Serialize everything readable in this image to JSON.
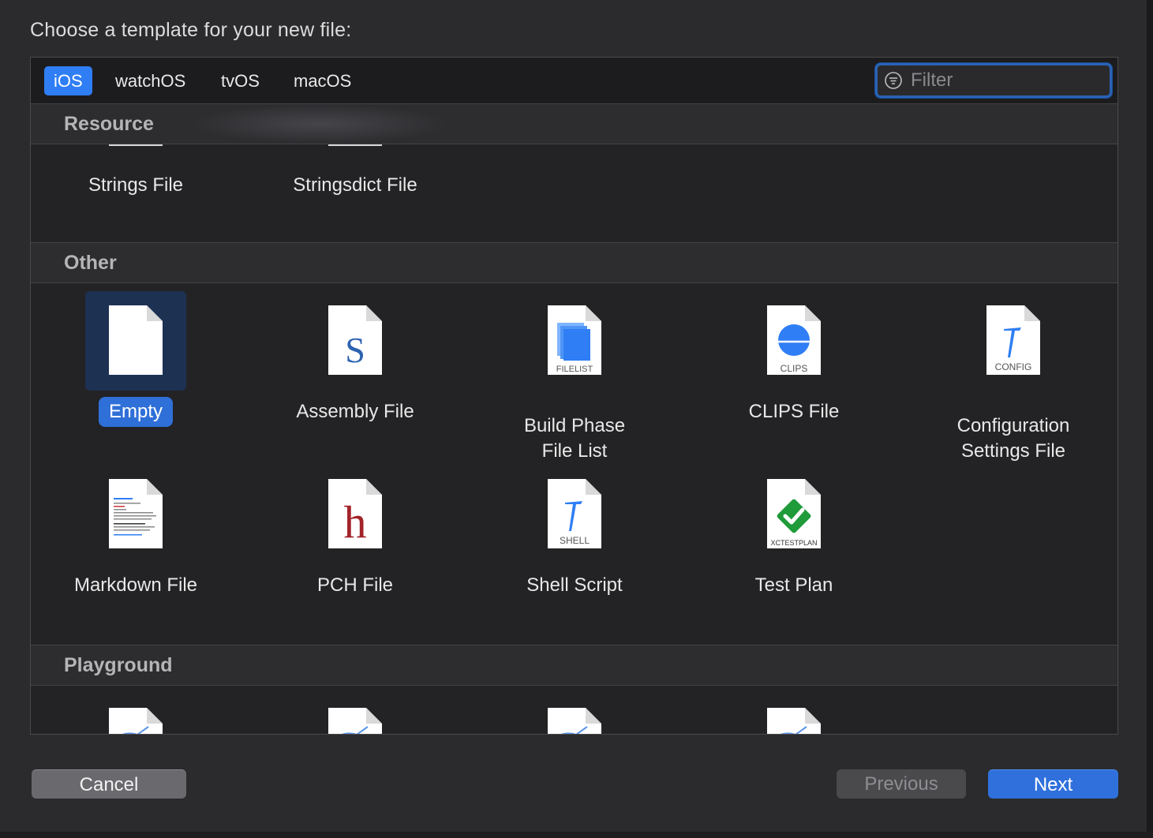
{
  "prompt": "Choose a template for your new file:",
  "tabs": [
    {
      "label": "iOS",
      "active": true
    },
    {
      "label": "watchOS"
    },
    {
      "label": "tvOS"
    },
    {
      "label": "macOS"
    }
  ],
  "filter": {
    "placeholder": "Filter"
  },
  "sections": {
    "resource": {
      "title": "Resource",
      "items": [
        {
          "label": "Strings File"
        },
        {
          "label": "Stringsdict File"
        }
      ]
    },
    "other": {
      "title": "Other",
      "items": [
        {
          "label": "Empty",
          "icon": "blank-file-icon",
          "selected": true
        },
        {
          "label": "Assembly File",
          "icon": "assembly-file-icon",
          "glyph": "S"
        },
        {
          "label": "Build Phase\nFile List",
          "icon": "filelist-file-icon",
          "badge": "FILELIST"
        },
        {
          "label": "CLIPS File",
          "icon": "clips-file-icon",
          "badge": "CLIPS"
        },
        {
          "label": "Configuration\nSettings File",
          "icon": "config-file-icon",
          "badge": "CONFIG"
        },
        {
          "label": "Markdown File",
          "icon": "markdown-file-icon"
        },
        {
          "label": "PCH File",
          "icon": "pch-file-icon",
          "glyph": "h"
        },
        {
          "label": "Shell Script",
          "icon": "shell-file-icon",
          "badge": "SHELL"
        },
        {
          "label": "Test Plan",
          "icon": "testplan-file-icon",
          "badge": "XCTESTPLAN"
        }
      ]
    },
    "playground": {
      "title": "Playground"
    }
  },
  "buttons": {
    "cancel": "Cancel",
    "previous": "Previous",
    "next": "Next"
  },
  "colors": {
    "accent": "#2f7ef5",
    "selection": "#1d3153",
    "background": "#232325"
  }
}
